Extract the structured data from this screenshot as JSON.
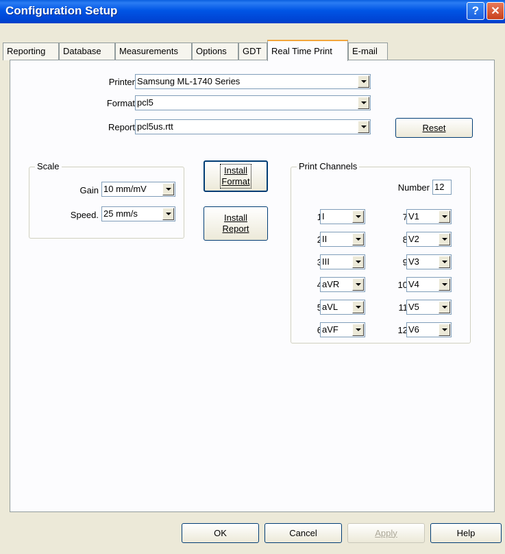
{
  "window": {
    "title": "Configuration Setup",
    "help_glyph": "?",
    "close_glyph": "✕"
  },
  "tabs": [
    "Reporting",
    "Database",
    "Measurements",
    "Options",
    "GDT",
    "Real Time Print",
    "E-mail"
  ],
  "active_tab": "Real Time Print",
  "printer": {
    "label": "Printer",
    "value": "Samsung ML-1740 Series"
  },
  "format": {
    "label": "Format",
    "value": "pcl5"
  },
  "report": {
    "label": "Report",
    "value": "pcl5us.rtt"
  },
  "buttons": {
    "reset": "Reset",
    "install_format_1": "Install",
    "install_format_2": "Format",
    "install_report_1": "Install",
    "install_report_2": "Report",
    "ok": "OK",
    "cancel": "Cancel",
    "apply": "Apply",
    "help": "Help"
  },
  "scale": {
    "title": "Scale",
    "gain_label": "Gain",
    "gain_value": "10 mm/mV",
    "speed_label": "Speed.",
    "speed_value": "25 mm/s"
  },
  "print_channels": {
    "title": "Print Channels",
    "number_label": "Number",
    "number_value": "12",
    "left": [
      {
        "num": "1",
        "val": "I"
      },
      {
        "num": "2",
        "val": "II"
      },
      {
        "num": "3",
        "val": "III"
      },
      {
        "num": "4",
        "val": "aVR"
      },
      {
        "num": "5",
        "val": "aVL"
      },
      {
        "num": "6",
        "val": "aVF"
      }
    ],
    "right": [
      {
        "num": "7",
        "val": "V1"
      },
      {
        "num": "8",
        "val": "V2"
      },
      {
        "num": "9",
        "val": "V3"
      },
      {
        "num": "10",
        "val": "V4"
      },
      {
        "num": "11",
        "val": "V5"
      },
      {
        "num": "12",
        "val": "V6"
      }
    ]
  }
}
